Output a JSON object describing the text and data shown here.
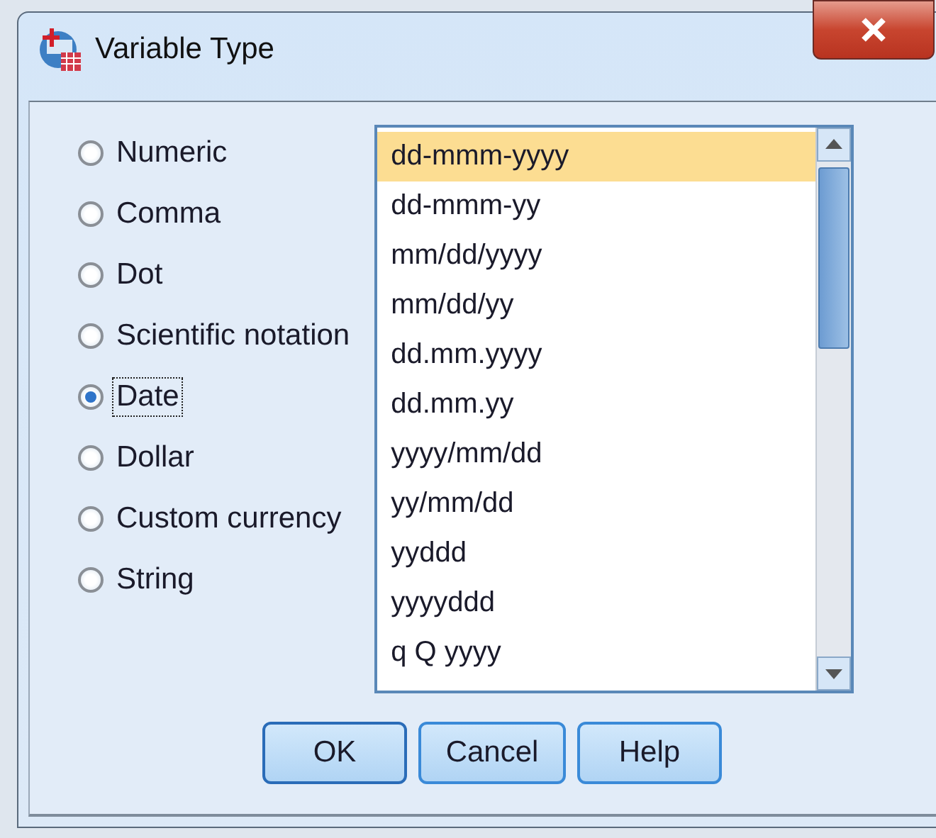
{
  "window": {
    "title": "Variable Type"
  },
  "types": [
    {
      "label": "Numeric",
      "selected": false
    },
    {
      "label": "Comma",
      "selected": false
    },
    {
      "label": "Dot",
      "selected": false
    },
    {
      "label": "Scientific notation",
      "selected": false
    },
    {
      "label": "Date",
      "selected": true
    },
    {
      "label": "Dollar",
      "selected": false
    },
    {
      "label": "Custom currency",
      "selected": false
    },
    {
      "label": "String",
      "selected": false
    }
  ],
  "formats": [
    {
      "label": "dd-mmm-yyyy",
      "selected": true
    },
    {
      "label": "dd-mmm-yy",
      "selected": false
    },
    {
      "label": "mm/dd/yyyy",
      "selected": false
    },
    {
      "label": "mm/dd/yy",
      "selected": false
    },
    {
      "label": "dd.mm.yyyy",
      "selected": false
    },
    {
      "label": "dd.mm.yy",
      "selected": false
    },
    {
      "label": "yyyy/mm/dd",
      "selected": false
    },
    {
      "label": "yy/mm/dd",
      "selected": false
    },
    {
      "label": "yyddd",
      "selected": false
    },
    {
      "label": "yyyyddd",
      "selected": false
    },
    {
      "label": "q Q yyyy",
      "selected": false
    }
  ],
  "buttons": [
    "OK",
    "Cancel",
    "Help"
  ]
}
